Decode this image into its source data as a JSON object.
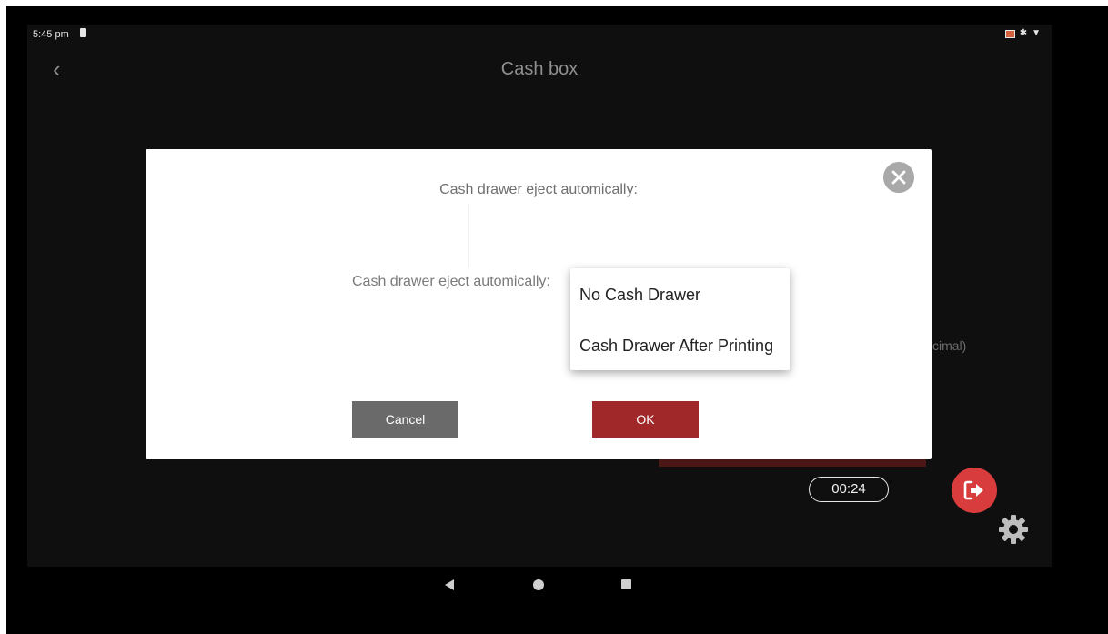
{
  "status_bar": {
    "time": "5:45 pm",
    "icons": [
      "sim-icon",
      "news-icon",
      "bluetooth-icon",
      "wifi-icon"
    ]
  },
  "app_bar": {
    "title": "Cash box",
    "back_icon": "chevron-left-icon"
  },
  "background": {
    "partial_text": "cimal)",
    "timer": "00:24",
    "logout_icon": "logout-icon",
    "settings_icon": "gear-icon"
  },
  "dialog": {
    "title": "Cash drawer eject automically:",
    "field_label": "Cash drawer eject automically:",
    "close_icon": "close-icon",
    "cancel_label": "Cancel",
    "ok_label": "OK"
  },
  "dropdown": {
    "options": [
      "No Cash Drawer",
      "Cash Drawer After Printing"
    ]
  },
  "nav_bar": {
    "icons": [
      "nav-back-icon",
      "nav-home-icon",
      "nav-recent-icon"
    ]
  },
  "colors": {
    "accent": "#a02828",
    "logout": "#d83c3c",
    "cancel": "#6a6a6a",
    "background": "#0f0f10"
  }
}
